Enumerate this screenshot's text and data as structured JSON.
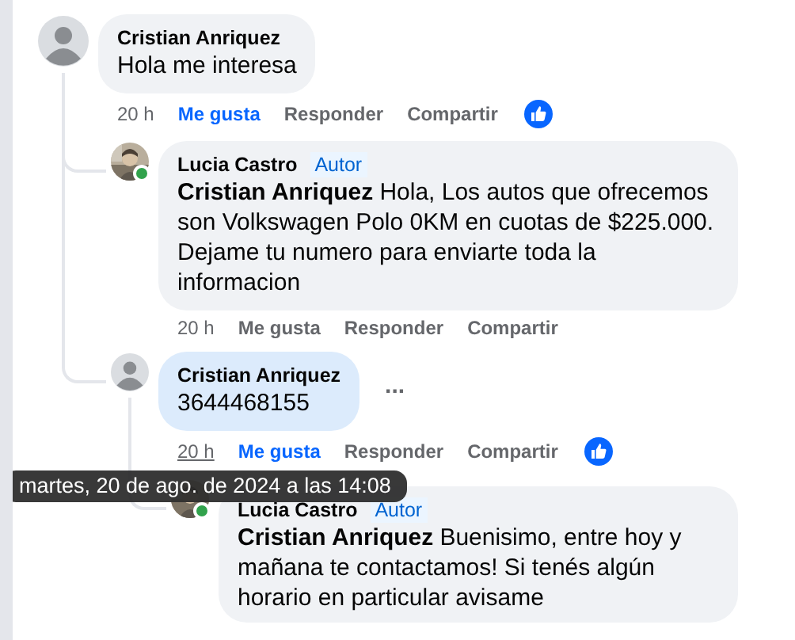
{
  "comments": [
    {
      "author": "Cristian Anriquez",
      "avatar": {
        "kind": "default"
      },
      "highlighted": false,
      "text": "Hola me interesa",
      "time": "20 h",
      "time_hovered": false,
      "actions": [
        {
          "label": "Me gusta",
          "selected": true
        },
        {
          "label": "Responder",
          "selected": false
        },
        {
          "label": "Compartir",
          "selected": false
        }
      ],
      "reaction": true,
      "replies": [
        {
          "author": "Lucia Castro",
          "badge": "Autor",
          "online": true,
          "highlighted": false,
          "mention": "Cristian Anriquez",
          "text": "Hola, Los autos que ofrecemos son Volkswagen Polo 0KM en cuotas de $225.000. Dejame tu numero para enviarte toda la informacion",
          "time": "20 h",
          "time_hovered": false,
          "actions": [
            {
              "label": "Me gusta",
              "selected": false
            },
            {
              "label": "Responder",
              "selected": false
            },
            {
              "label": "Compartir",
              "selected": false
            }
          ]
        },
        {
          "author": "Cristian Anriquez",
          "avatar": {
            "kind": "default"
          },
          "highlighted": true,
          "text": "3644468155",
          "more_menu": "...",
          "time": "20 h",
          "time_hovered": true,
          "actions": [
            {
              "label": "Me gusta",
              "selected": true
            },
            {
              "label": "Responder",
              "selected": false
            },
            {
              "label": "Compartir",
              "selected": false
            }
          ],
          "reaction": true,
          "replies": [
            {
              "author": "Lucia Castro",
              "badge": "Autor",
              "online": true,
              "highlighted": false,
              "mention": "Cristian Anriquez",
              "text": "Buenisimo, entre hoy y mañana te contactamos! Si tenés algún horario en particular avisame"
            }
          ]
        }
      ]
    }
  ],
  "tooltip": {
    "text": "martes, 20 de ago. de 2024 a las 14:08"
  }
}
